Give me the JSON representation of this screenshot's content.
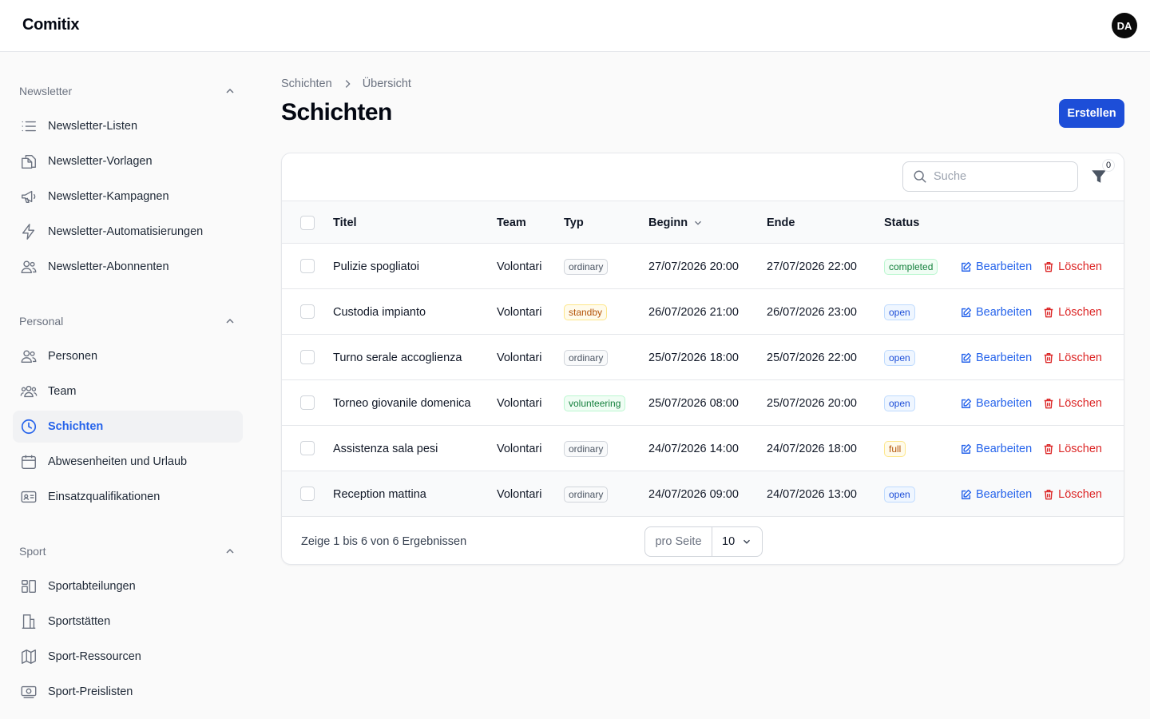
{
  "app": {
    "brand": "Comitix",
    "user_initials": "DA"
  },
  "sidebar": {
    "groups": [
      {
        "label": "Newsletter",
        "items": [
          {
            "label": "Newsletter-Listen",
            "icon": "list-icon"
          },
          {
            "label": "Newsletter-Vorlagen",
            "icon": "documents-icon"
          },
          {
            "label": "Newsletter-Kampagnen",
            "icon": "megaphone-icon"
          },
          {
            "label": "Newsletter-Automatisierungen",
            "icon": "bolt-icon"
          },
          {
            "label": "Newsletter-Abonnenten",
            "icon": "users-icon"
          }
        ]
      },
      {
        "label": "Personal",
        "items": [
          {
            "label": "Personen",
            "icon": "users-icon"
          },
          {
            "label": "Team",
            "icon": "user-group-icon"
          },
          {
            "label": "Schichten",
            "icon": "clock-icon",
            "active": true
          },
          {
            "label": "Abwesenheiten und Urlaub",
            "icon": "calendar-icon"
          },
          {
            "label": "Einsatzqualifikationen",
            "icon": "id-card-icon"
          }
        ]
      },
      {
        "label": "Sport",
        "items": [
          {
            "label": "Sportabteilungen",
            "icon": "layout-icon"
          },
          {
            "label": "Sportstätten",
            "icon": "building-icon"
          },
          {
            "label": "Sport-Ressourcen",
            "icon": "map-icon"
          },
          {
            "label": "Sport-Preislisten",
            "icon": "banknote-icon"
          }
        ]
      }
    ]
  },
  "page": {
    "breadcrumb": [
      "Schichten",
      "Übersicht"
    ],
    "title": "Schichten",
    "create_label": "Erstellen"
  },
  "table": {
    "search_placeholder": "Suche",
    "filter_count": "0",
    "columns": {
      "title": "Titel",
      "team": "Team",
      "type": "Typ",
      "start": "Beginn",
      "end": "Ende",
      "status": "Status"
    },
    "edit_label": "Bearbeiten",
    "delete_label": "Löschen",
    "rows": [
      {
        "title": "Pulizie spogliatoi",
        "team": "Volontari",
        "type": "ordinary",
        "start": "27/07/2026 20:00",
        "end": "27/07/2026 22:00",
        "status": "completed"
      },
      {
        "title": "Custodia impianto",
        "team": "Volontari",
        "type": "standby",
        "start": "26/07/2026 21:00",
        "end": "26/07/2026 23:00",
        "status": "open"
      },
      {
        "title": "Turno serale accoglienza",
        "team": "Volontari",
        "type": "ordinary",
        "start": "25/07/2026 18:00",
        "end": "25/07/2026 22:00",
        "status": "open"
      },
      {
        "title": "Torneo giovanile domenica",
        "team": "Volontari",
        "type": "volunteering",
        "start": "25/07/2026 08:00",
        "end": "25/07/2026 20:00",
        "status": "open"
      },
      {
        "title": "Assistenza sala pesi",
        "team": "Volontari",
        "type": "ordinary",
        "start": "24/07/2026 14:00",
        "end": "24/07/2026 18:00",
        "status": "full"
      },
      {
        "title": "Reception mattina",
        "team": "Volontari",
        "type": "ordinary",
        "start": "24/07/2026 09:00",
        "end": "24/07/2026 13:00",
        "status": "open"
      }
    ],
    "footer": {
      "results_text": "Zeige 1 bis 6 von 6 Ergebnissen",
      "per_page_label": "pro Seite",
      "per_page_value": "10"
    }
  },
  "colors": {
    "accent": "#1d4ed8",
    "link": "#2563eb",
    "danger": "#dc2626",
    "badge_gray": "#4b5563",
    "badge_amber": "#b45309",
    "badge_green": "#15803d",
    "badge_blue": "#1d4ed8"
  }
}
